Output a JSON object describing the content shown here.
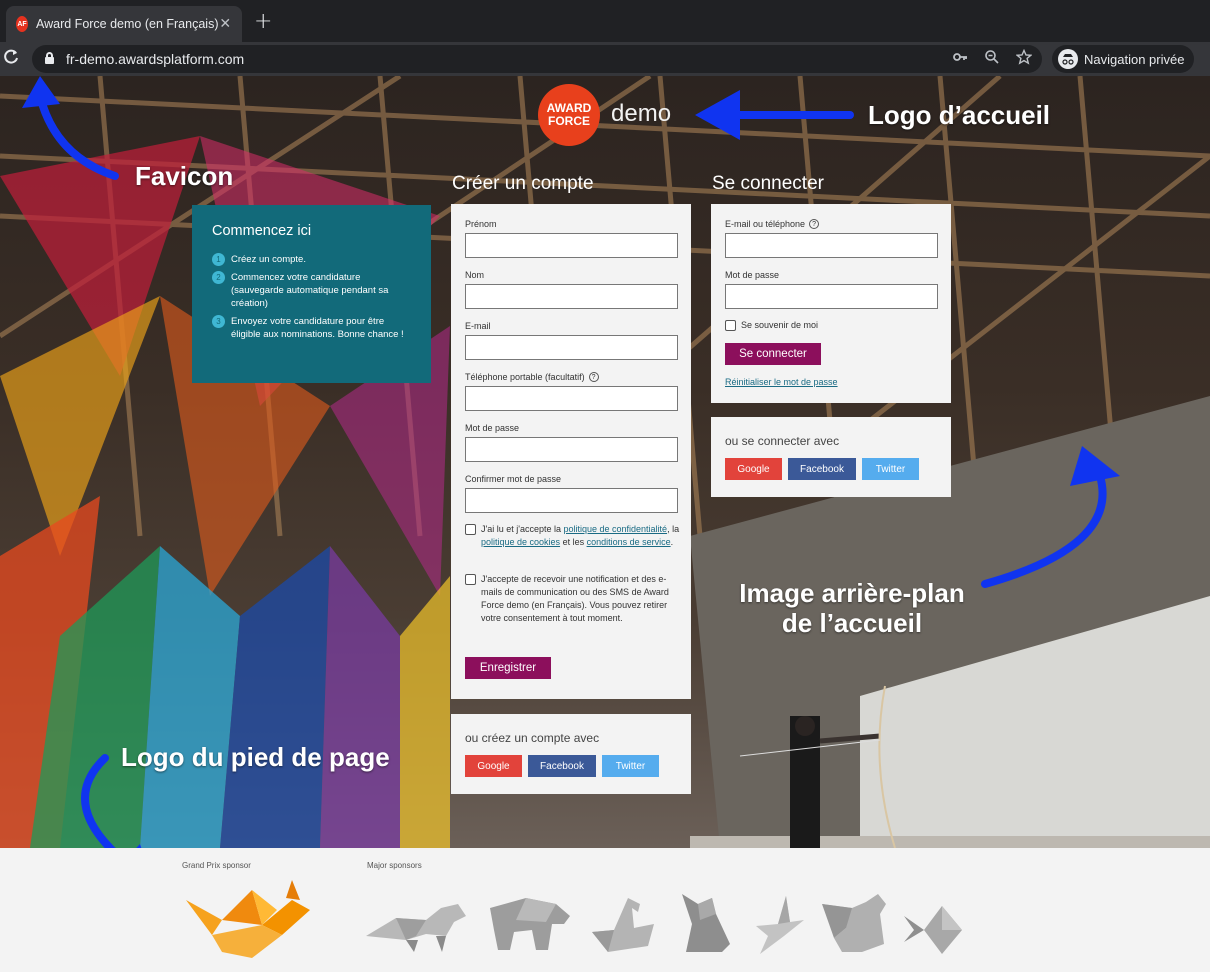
{
  "browser": {
    "tab_title": "Award Force demo (en Français)",
    "favicon_text": "AF",
    "new_tab": "+",
    "close": "✕",
    "url": "fr-demo.awardsplatform.com",
    "incognito_label": "Navigation privée"
  },
  "header": {
    "logo_line1": "AWARD",
    "logo_line2": "FORCE",
    "logo_suffix": "demo"
  },
  "annotations": {
    "favicon": "Favicon",
    "home_logo": "Logo d’accueil",
    "background_line1": "Image arrière-plan",
    "background_line2": "de l’accueil",
    "footer_logo": "Logo du pied de page"
  },
  "start": {
    "title": "Commencez ici",
    "steps": [
      {
        "n": "1",
        "text": "Créez un compte."
      },
      {
        "n": "2",
        "text": "Commencez votre candidature (sauvegarde automatique pendant sa création)"
      },
      {
        "n": "3",
        "text": "Envoyez votre candidature pour être éligible aux nominations. Bonne chance !"
      }
    ]
  },
  "register": {
    "title": "Créer un compte",
    "first_name": "Prénom",
    "last_name": "Nom",
    "email": "E-mail",
    "mobile": "Téléphone portable (facultatif)",
    "password": "Mot de passe",
    "confirm_password": "Confirmer mot de passe",
    "agree_pre": "J'ai lu et j'accepte la ",
    "privacy_link": "politique de confidentialité",
    "agree_mid1": ", la ",
    "cookies_link": "politique de cookies",
    "agree_mid2": " et les ",
    "terms_link": "conditions de service",
    "agree_end": ".",
    "consent": "J'accepte de recevoir une notification et des e-mails de communication ou des SMS de Award Force demo (en Français). Vous pouvez retirer votre consentement à tout moment.",
    "submit": "Enregistrer",
    "social_title": "ou créez un compte avec",
    "google": "Google",
    "facebook": "Facebook",
    "twitter": "Twitter"
  },
  "login": {
    "title": "Se connecter",
    "email_phone": "E-mail ou téléphone",
    "password": "Mot de passe",
    "remember": "Se souvenir de moi",
    "submit": "Se connecter",
    "reset": "Réinitialiser le mot de passe",
    "social_title": "ou se connecter avec",
    "google": "Google",
    "facebook": "Facebook",
    "twitter": "Twitter"
  },
  "footer": {
    "grand_prix": "Grand Prix sponsor",
    "major": "Major sponsors"
  },
  "colors": {
    "brand_orange": "#e8401c",
    "start_teal": "#126a7a",
    "primary_button": "#8c0f5c",
    "annotation_arrow": "#1034f0"
  }
}
